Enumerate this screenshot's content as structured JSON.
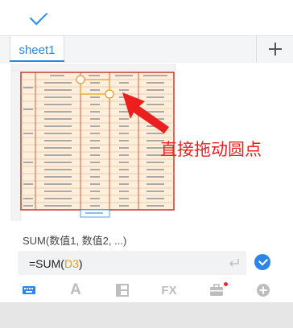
{
  "tabs": {
    "sheet_name": "sheet1"
  },
  "annotation": {
    "text": "直接拖动圆点"
  },
  "formula": {
    "hint": "SUM(数值1, 数值2, ...)",
    "prefix": "=SUM(",
    "ref": "D3",
    "suffix": ")"
  },
  "toolbar": {
    "items": [
      "keyboard-icon",
      "font-icon",
      "layout-icon",
      "fx-icon",
      "briefcase-icon",
      "add-icon"
    ],
    "fx_label": "FX",
    "font_label": "A",
    "notification_color": "#e8292b"
  },
  "colors": {
    "accent": "#2a86e8",
    "annotation": "#ec1f1f",
    "formula_ref": "#e89a22",
    "sheet_fill": "#fdefd9",
    "sheet_border": "#c33b2f"
  }
}
